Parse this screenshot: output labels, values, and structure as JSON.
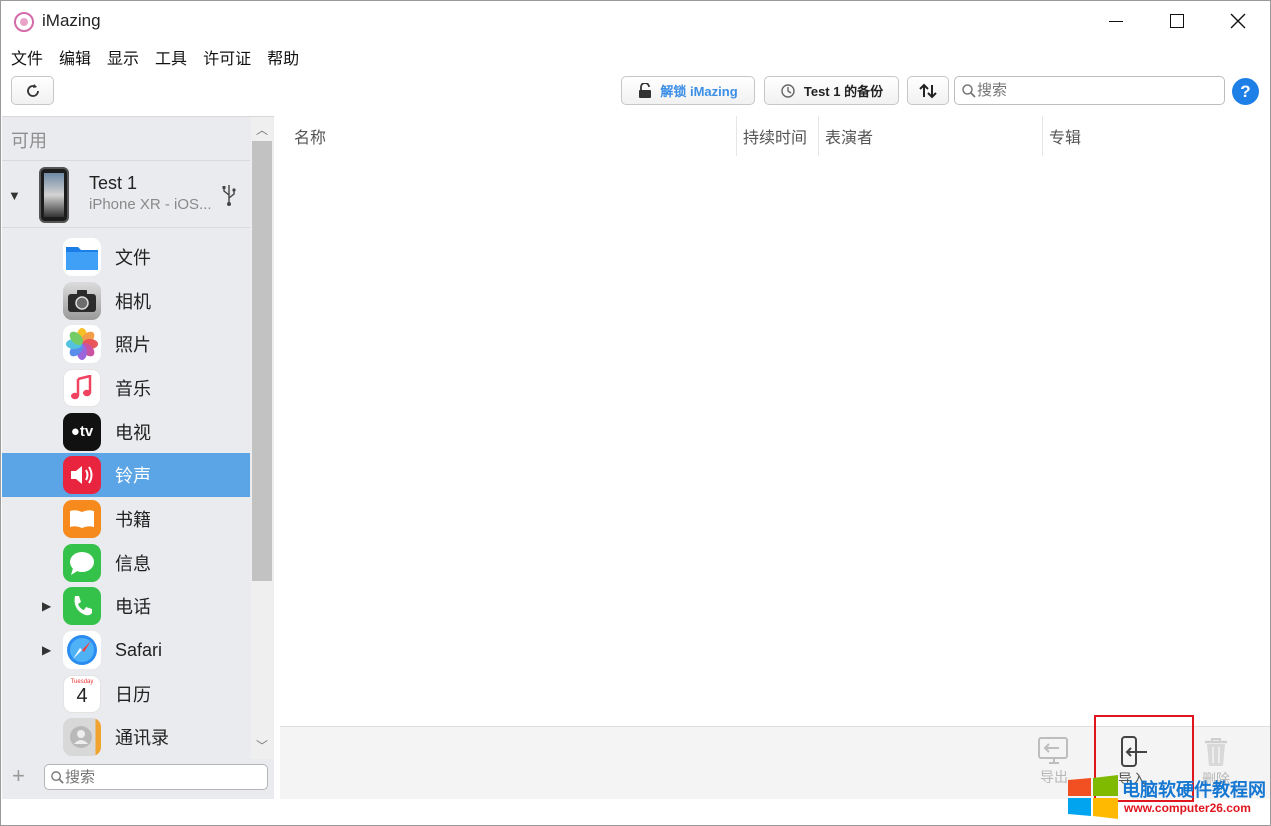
{
  "window": {
    "title": "iMazing",
    "controls": {
      "minimize": "minimize",
      "maximize": "maximize",
      "close": "close"
    }
  },
  "menu": [
    "文件",
    "编辑",
    "显示",
    "工具",
    "许可证",
    "帮助"
  ],
  "toolbar": {
    "unlock_label": "解锁 iMazing",
    "backup_label": "Test 1 的备份",
    "search_placeholder": "搜索",
    "help_label": "?"
  },
  "sidebar": {
    "heading": "可用",
    "device": {
      "name": "Test 1",
      "model": "iPhone XR - iOS..."
    },
    "items": [
      {
        "label": "文件",
        "icon": "files-icon",
        "expandable": false,
        "selected": false
      },
      {
        "label": "相机",
        "icon": "camera-icon",
        "expandable": false,
        "selected": false
      },
      {
        "label": "照片",
        "icon": "photos-icon",
        "expandable": false,
        "selected": false
      },
      {
        "label": "音乐",
        "icon": "music-icon",
        "expandable": false,
        "selected": false
      },
      {
        "label": "电视",
        "icon": "tv-icon",
        "expandable": false,
        "selected": false
      },
      {
        "label": "铃声",
        "icon": "ringtone-icon",
        "expandable": false,
        "selected": true
      },
      {
        "label": "书籍",
        "icon": "books-icon",
        "expandable": false,
        "selected": false
      },
      {
        "label": "信息",
        "icon": "messages-icon",
        "expandable": false,
        "selected": false
      },
      {
        "label": "电话",
        "icon": "phone-icon",
        "expandable": true,
        "selected": false
      },
      {
        "label": "Safari",
        "icon": "safari-icon",
        "expandable": true,
        "selected": false
      },
      {
        "label": "日历",
        "icon": "calendar-icon",
        "expandable": false,
        "selected": false
      },
      {
        "label": "通讯录",
        "icon": "contacts-icon",
        "expandable": false,
        "selected": false
      }
    ],
    "calendar_day": "4",
    "calendar_weekday": "Tuesday",
    "search_placeholder": "搜索"
  },
  "table": {
    "columns": [
      "名称",
      "持续时间",
      "表演者",
      "专辑"
    ],
    "rows": []
  },
  "actions": {
    "export_label": "导出",
    "import_label": "导入",
    "delete_label": "删除"
  },
  "watermark": {
    "text": "电脑软硬件教程网",
    "url": "www.computer26.com"
  },
  "colors": {
    "selection": "#5ba4e5",
    "accent": "#1e7fe6",
    "highlight_box": "#e0161e"
  }
}
